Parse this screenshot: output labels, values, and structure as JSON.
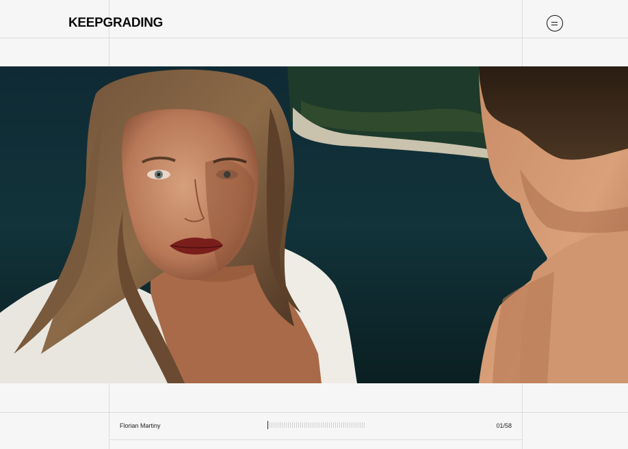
{
  "brand": {
    "logo_text": "KEEPGRADING"
  },
  "header": {
    "menu_icon": "menu-circle-icon"
  },
  "hero": {
    "image_description_icon": "photo"
  },
  "footer": {
    "photographer_name": "Florian Martiny",
    "progress_fraction": 0.017,
    "counter": "01/58"
  },
  "colors": {
    "background": "#f6f6f6",
    "grid_line": "#dcdcdc",
    "text": "#111111"
  }
}
